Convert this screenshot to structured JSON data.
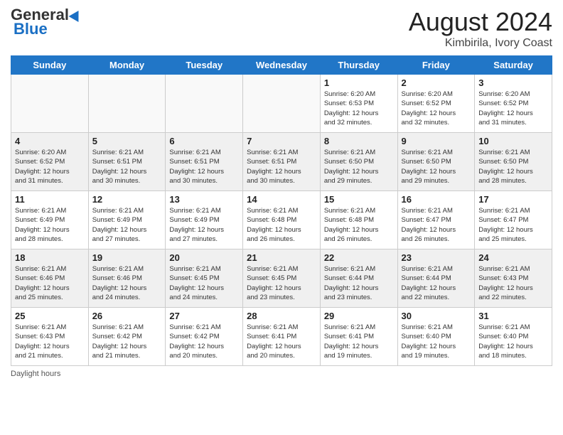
{
  "header": {
    "logo_general": "General",
    "logo_blue": "Blue",
    "title": "August 2024",
    "subtitle": "Kimbirila, Ivory Coast"
  },
  "days_of_week": [
    "Sunday",
    "Monday",
    "Tuesday",
    "Wednesday",
    "Thursday",
    "Friday",
    "Saturday"
  ],
  "footer_text": "Daylight hours",
  "weeks": [
    [
      {
        "day": "",
        "info": ""
      },
      {
        "day": "",
        "info": ""
      },
      {
        "day": "",
        "info": ""
      },
      {
        "day": "",
        "info": ""
      },
      {
        "day": "1",
        "info": "Sunrise: 6:20 AM\nSunset: 6:53 PM\nDaylight: 12 hours\nand 32 minutes."
      },
      {
        "day": "2",
        "info": "Sunrise: 6:20 AM\nSunset: 6:52 PM\nDaylight: 12 hours\nand 32 minutes."
      },
      {
        "day": "3",
        "info": "Sunrise: 6:20 AM\nSunset: 6:52 PM\nDaylight: 12 hours\nand 31 minutes."
      }
    ],
    [
      {
        "day": "4",
        "info": "Sunrise: 6:20 AM\nSunset: 6:52 PM\nDaylight: 12 hours\nand 31 minutes."
      },
      {
        "day": "5",
        "info": "Sunrise: 6:21 AM\nSunset: 6:51 PM\nDaylight: 12 hours\nand 30 minutes."
      },
      {
        "day": "6",
        "info": "Sunrise: 6:21 AM\nSunset: 6:51 PM\nDaylight: 12 hours\nand 30 minutes."
      },
      {
        "day": "7",
        "info": "Sunrise: 6:21 AM\nSunset: 6:51 PM\nDaylight: 12 hours\nand 30 minutes."
      },
      {
        "day": "8",
        "info": "Sunrise: 6:21 AM\nSunset: 6:50 PM\nDaylight: 12 hours\nand 29 minutes."
      },
      {
        "day": "9",
        "info": "Sunrise: 6:21 AM\nSunset: 6:50 PM\nDaylight: 12 hours\nand 29 minutes."
      },
      {
        "day": "10",
        "info": "Sunrise: 6:21 AM\nSunset: 6:50 PM\nDaylight: 12 hours\nand 28 minutes."
      }
    ],
    [
      {
        "day": "11",
        "info": "Sunrise: 6:21 AM\nSunset: 6:49 PM\nDaylight: 12 hours\nand 28 minutes."
      },
      {
        "day": "12",
        "info": "Sunrise: 6:21 AM\nSunset: 6:49 PM\nDaylight: 12 hours\nand 27 minutes."
      },
      {
        "day": "13",
        "info": "Sunrise: 6:21 AM\nSunset: 6:49 PM\nDaylight: 12 hours\nand 27 minutes."
      },
      {
        "day": "14",
        "info": "Sunrise: 6:21 AM\nSunset: 6:48 PM\nDaylight: 12 hours\nand 26 minutes."
      },
      {
        "day": "15",
        "info": "Sunrise: 6:21 AM\nSunset: 6:48 PM\nDaylight: 12 hours\nand 26 minutes."
      },
      {
        "day": "16",
        "info": "Sunrise: 6:21 AM\nSunset: 6:47 PM\nDaylight: 12 hours\nand 26 minutes."
      },
      {
        "day": "17",
        "info": "Sunrise: 6:21 AM\nSunset: 6:47 PM\nDaylight: 12 hours\nand 25 minutes."
      }
    ],
    [
      {
        "day": "18",
        "info": "Sunrise: 6:21 AM\nSunset: 6:46 PM\nDaylight: 12 hours\nand 25 minutes."
      },
      {
        "day": "19",
        "info": "Sunrise: 6:21 AM\nSunset: 6:46 PM\nDaylight: 12 hours\nand 24 minutes."
      },
      {
        "day": "20",
        "info": "Sunrise: 6:21 AM\nSunset: 6:45 PM\nDaylight: 12 hours\nand 24 minutes."
      },
      {
        "day": "21",
        "info": "Sunrise: 6:21 AM\nSunset: 6:45 PM\nDaylight: 12 hours\nand 23 minutes."
      },
      {
        "day": "22",
        "info": "Sunrise: 6:21 AM\nSunset: 6:44 PM\nDaylight: 12 hours\nand 23 minutes."
      },
      {
        "day": "23",
        "info": "Sunrise: 6:21 AM\nSunset: 6:44 PM\nDaylight: 12 hours\nand 22 minutes."
      },
      {
        "day": "24",
        "info": "Sunrise: 6:21 AM\nSunset: 6:43 PM\nDaylight: 12 hours\nand 22 minutes."
      }
    ],
    [
      {
        "day": "25",
        "info": "Sunrise: 6:21 AM\nSunset: 6:43 PM\nDaylight: 12 hours\nand 21 minutes."
      },
      {
        "day": "26",
        "info": "Sunrise: 6:21 AM\nSunset: 6:42 PM\nDaylight: 12 hours\nand 21 minutes."
      },
      {
        "day": "27",
        "info": "Sunrise: 6:21 AM\nSunset: 6:42 PM\nDaylight: 12 hours\nand 20 minutes."
      },
      {
        "day": "28",
        "info": "Sunrise: 6:21 AM\nSunset: 6:41 PM\nDaylight: 12 hours\nand 20 minutes."
      },
      {
        "day": "29",
        "info": "Sunrise: 6:21 AM\nSunset: 6:41 PM\nDaylight: 12 hours\nand 19 minutes."
      },
      {
        "day": "30",
        "info": "Sunrise: 6:21 AM\nSunset: 6:40 PM\nDaylight: 12 hours\nand 19 minutes."
      },
      {
        "day": "31",
        "info": "Sunrise: 6:21 AM\nSunset: 6:40 PM\nDaylight: 12 hours\nand 18 minutes."
      }
    ]
  ]
}
